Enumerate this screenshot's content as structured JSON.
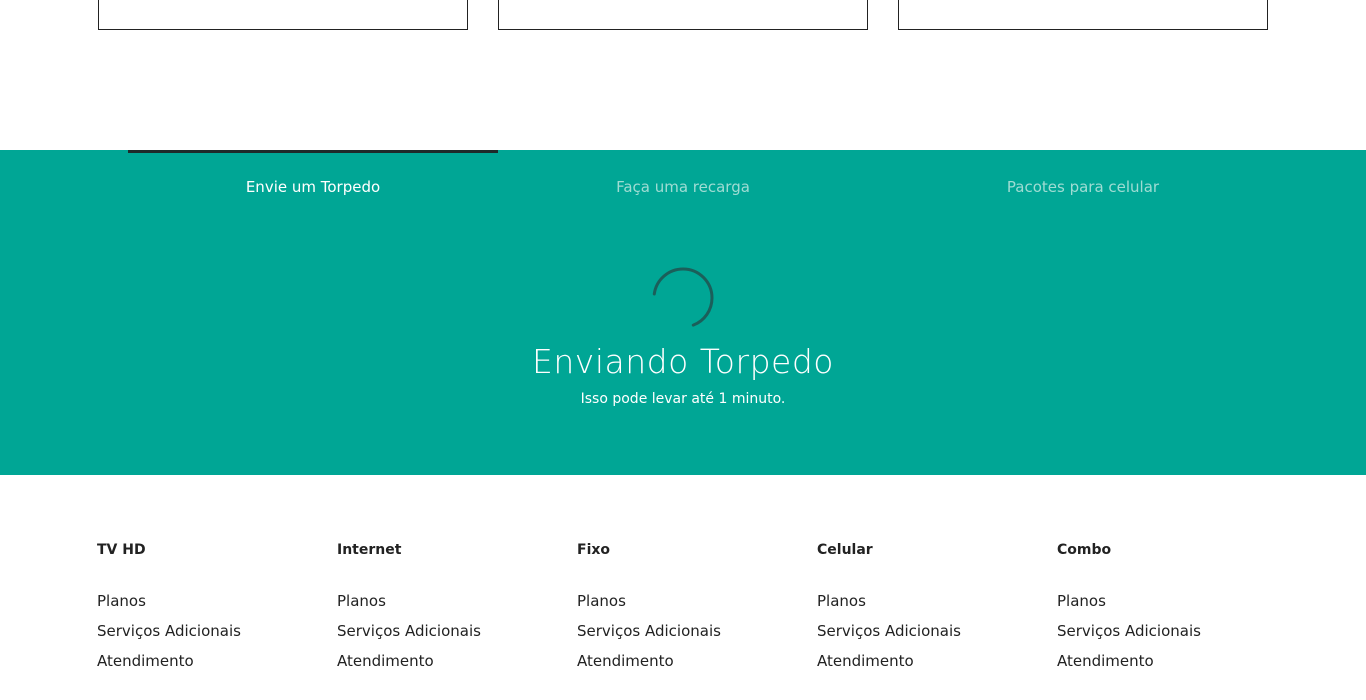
{
  "tabs": [
    {
      "label": "Envie um Torpedo",
      "active": true
    },
    {
      "label": "Faça uma recarga",
      "active": false
    },
    {
      "label": "Pacotes para celular",
      "active": false
    }
  ],
  "status": {
    "title": "Enviando Torpedo",
    "subtitle": "Isso pode levar até 1 minuto."
  },
  "footer": {
    "columns": [
      {
        "title": "TV HD",
        "links": [
          "Planos",
          "Serviços Adicionais",
          "Atendimento"
        ]
      },
      {
        "title": "Internet",
        "links": [
          "Planos",
          "Serviços Adicionais",
          "Atendimento"
        ]
      },
      {
        "title": "Fixo",
        "links": [
          "Planos",
          "Serviços Adicionais",
          "Atendimento"
        ]
      },
      {
        "title": "Celular",
        "links": [
          "Planos",
          "Serviços Adicionais",
          "Atendimento"
        ]
      },
      {
        "title": "Combo",
        "links": [
          "Planos",
          "Serviços Adicionais",
          "Atendimento"
        ]
      }
    ]
  },
  "colors": {
    "panel_background": "#00a695",
    "active_tab_indicator": "#1e2a2a",
    "inactive_tab_text": "#9fdcd3",
    "spinner": "#1b5f5a"
  },
  "icons": {
    "spinner": "loading-spinner-icon"
  }
}
